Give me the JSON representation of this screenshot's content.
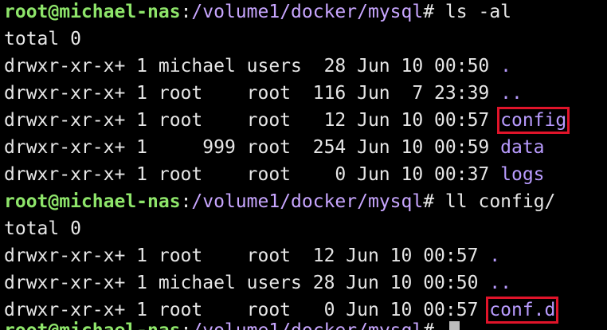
{
  "terminal": {
    "prompt1": {
      "host": "root@michael-nas",
      "sep": ":",
      "path": "/volume1/docker/mysql",
      "symbol": "#",
      "command": " ls -al"
    },
    "lines1": [
      {
        "text": "total 0"
      },
      {
        "meta": "drwxr-xr-x+ 1 michael users  28 Jun 10 00:50 ",
        "name": "."
      },
      {
        "meta": "drwxr-xr-x+ 1 root    root  116 Jun  7 23:39 ",
        "name": ".."
      },
      {
        "meta": "drwxr-xr-x+ 1 root    root   12 Jun 10 00:57 ",
        "name": "config"
      },
      {
        "meta": "drwxr-xr-x+ 1     999 root  254 Jun 10 00:59 ",
        "name": "data"
      },
      {
        "meta": "drwxr-xr-x+ 1 root    root    0 Jun 10 00:37 ",
        "name": "logs"
      }
    ],
    "prompt2": {
      "host": "root@michael-nas",
      "sep": ":",
      "path": "/volume1/docker/mysql",
      "symbol": "#",
      "command": " ll config/"
    },
    "lines2": [
      {
        "text": "total 0"
      },
      {
        "meta": "drwxr-xr-x+ 1 root    root  12 Jun 10 00:57 ",
        "name": "."
      },
      {
        "meta": "drwxr-xr-x+ 1 michael users 28 Jun 10 00:50 ",
        "name": ".."
      },
      {
        "meta": "drwxr-xr-x+ 1 root    root   0 Jun 10 00:57 ",
        "name": "conf.d"
      }
    ],
    "colors": {
      "background": "#000000",
      "text": "#e6e6e6",
      "host": "#8ee56a",
      "path": "#c8a6ff",
      "directory": "#b99cff",
      "highlight_box": "#e0142a"
    }
  }
}
